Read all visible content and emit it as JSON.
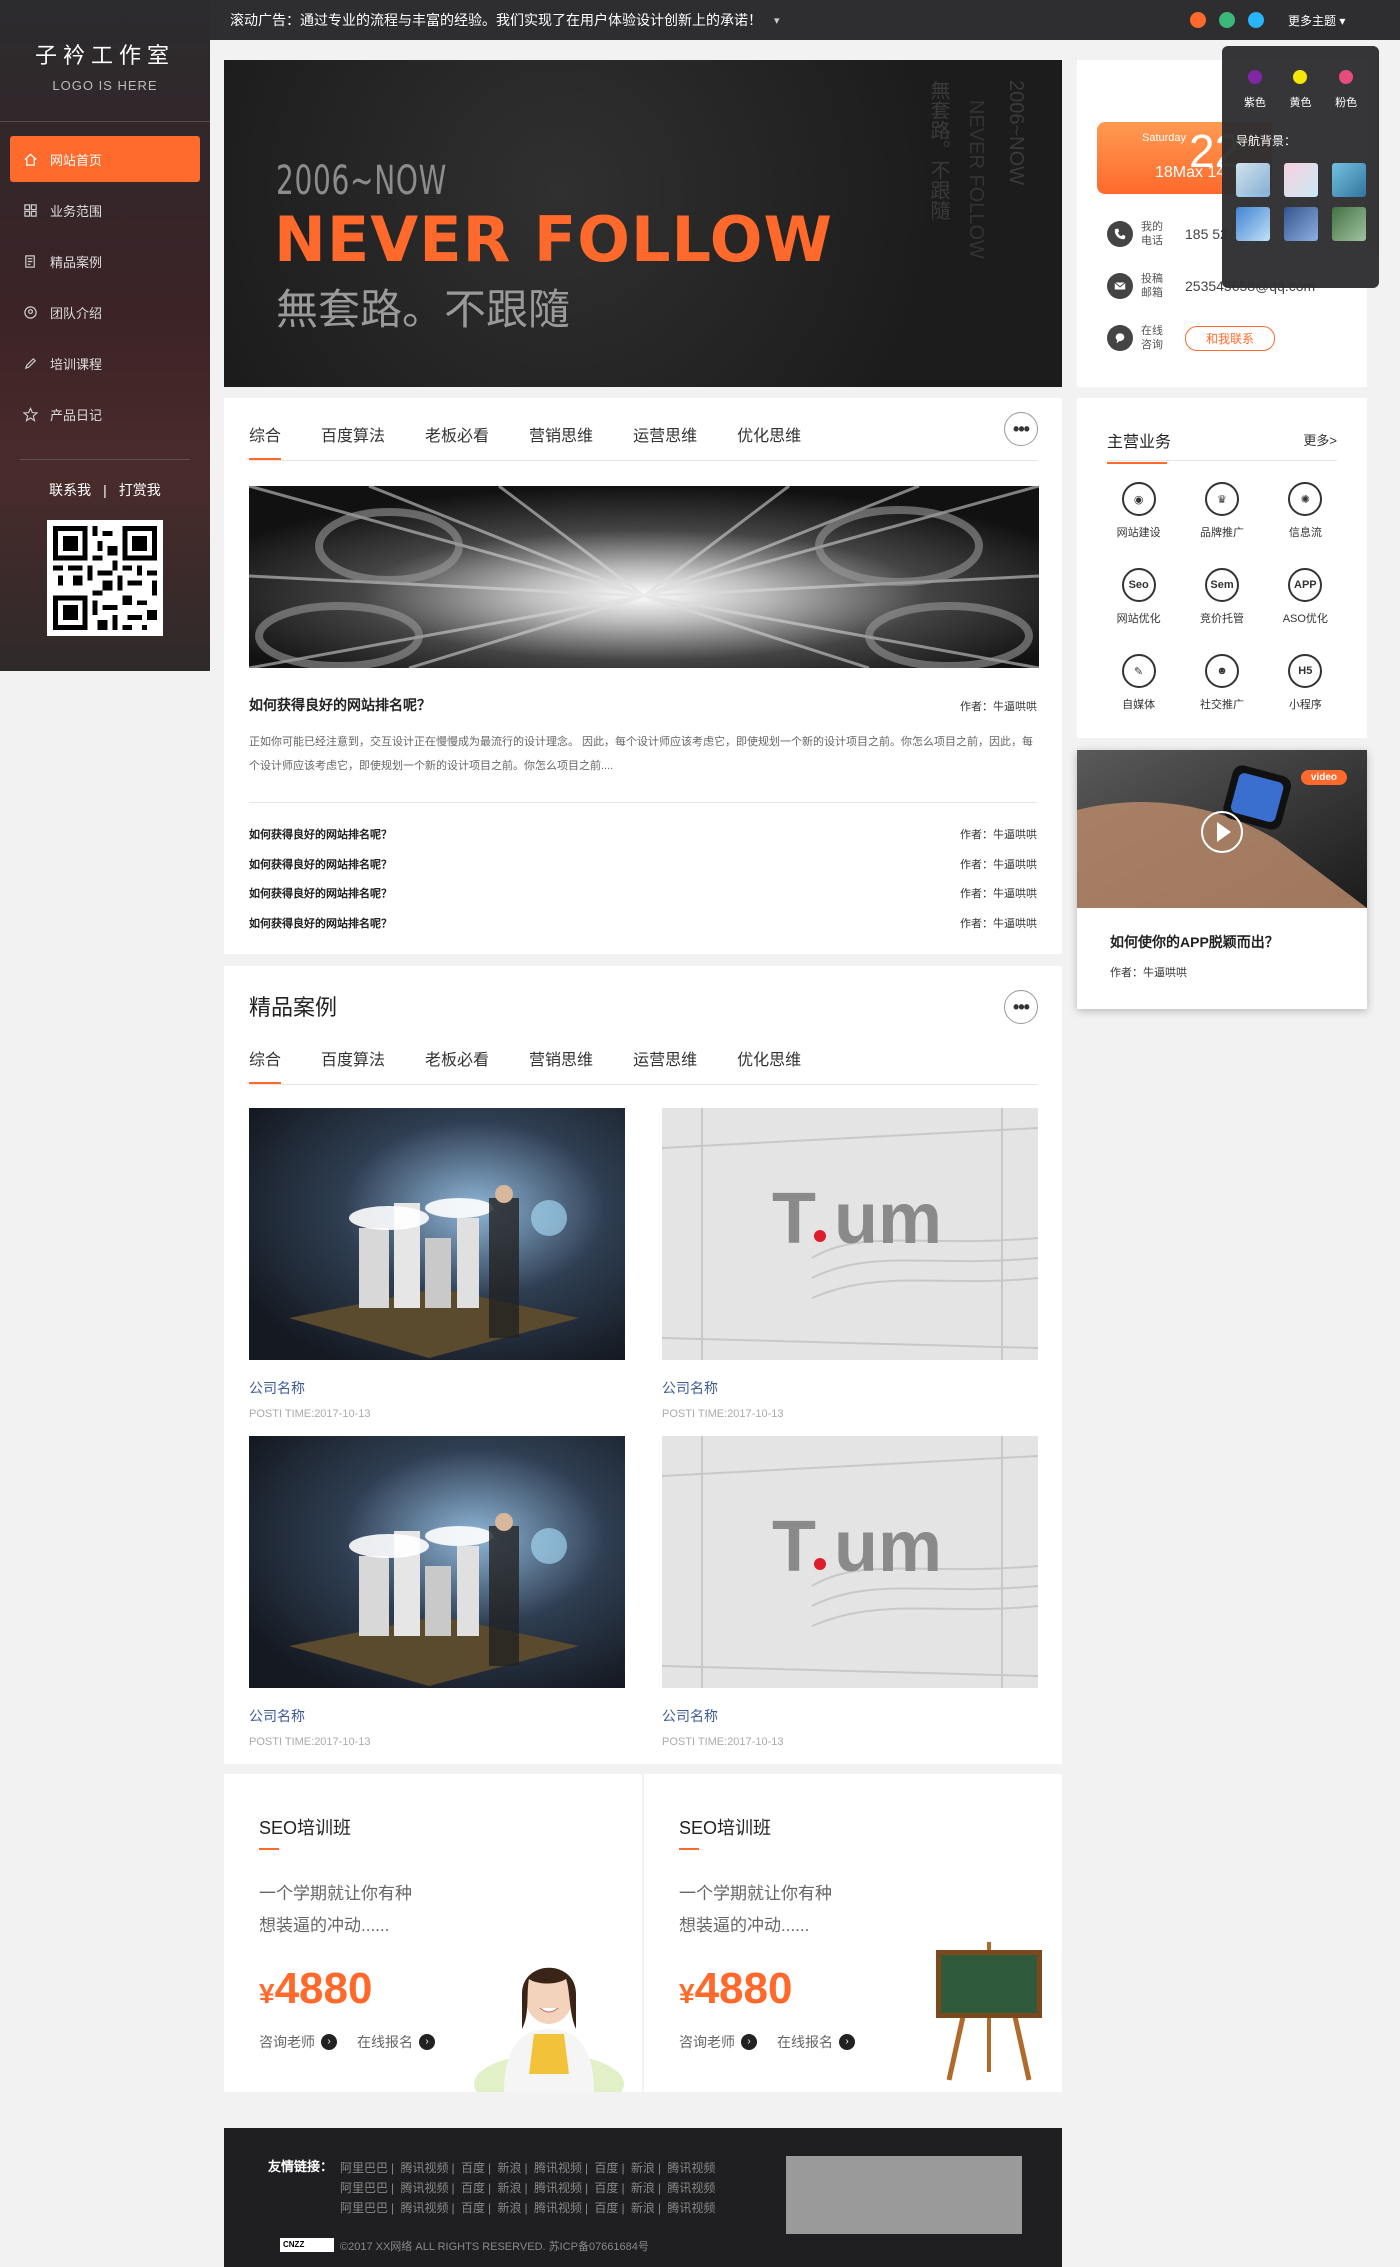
{
  "brand": {
    "name_cn": "子衿工作室",
    "logo_text": "LOGO IS HERE"
  },
  "sidebar": {
    "items": [
      {
        "label": "网站首页",
        "icon": "home-icon",
        "active": true
      },
      {
        "label": "业务范围",
        "icon": "grid-icon"
      },
      {
        "label": "精品案例",
        "icon": "document-icon"
      },
      {
        "label": "团队介绍",
        "icon": "team-icon"
      },
      {
        "label": "培训课程",
        "icon": "pen-icon"
      },
      {
        "label": "产品日记",
        "icon": "star-icon"
      }
    ],
    "link_contact": "联系我",
    "link_separator": "|",
    "link_tip": "打赏我"
  },
  "topbar": {
    "marquee": "滚动广告：通过专业的流程与丰富的经验。我们实现了在用户体验设计创新上的承诺！",
    "more_theme": "更多主题 ▾",
    "dot_colors": [
      "#ff6a2c",
      "#3cb878",
      "#29b6f6"
    ]
  },
  "hero": {
    "year_line": "2006~NOW",
    "headline": "NEVER FOLLOW",
    "subline": "無套路。不跟隨"
  },
  "info": {
    "weekday": "Saturday",
    "day": "22",
    "temps": "18Max 14",
    "phone_label": "我的电话",
    "phone_value": "185 52",
    "email_label": "投稿邮箱",
    "email_value": "253545658@qq.com",
    "consult_label": "在线咨询",
    "consult_button": "和我联系"
  },
  "theme_popup": {
    "colors": [
      {
        "label": "紫色",
        "color": "#7a1fa2"
      },
      {
        "label": "黄色",
        "color": "#f5e400"
      },
      {
        "label": "粉色",
        "color": "#e8457a"
      }
    ],
    "bg_label": "导航背景："
  },
  "news": {
    "tabs": [
      "综合",
      "百度算法",
      "老板必看",
      "营销思维",
      "运营思维",
      "优化思维"
    ],
    "more": "•••",
    "feature_title": "如何获得良好的网站排名呢？",
    "feature_author": "作者：牛逼哄哄",
    "feature_desc": "正如你可能已经注意到，交互设计正在慢慢成为最流行的设计理念。 因此，每个设计师应该考虑它，即使规划一个新的设计项目之前。你怎么项目之前，因此，每个设计师应该考虑它，即使规划一个新的设计项目之前。你怎么项目之前....",
    "list": [
      {
        "title": "如何获得良好的网站排名呢？",
        "author": "作者：牛逼哄哄"
      },
      {
        "title": "如何获得良好的网站排名呢？",
        "author": "作者：牛逼哄哄"
      },
      {
        "title": "如何获得良好的网站排名呢？",
        "author": "作者：牛逼哄哄"
      },
      {
        "title": "如何获得良好的网站排名呢？",
        "author": "作者：牛逼哄哄"
      }
    ]
  },
  "cases": {
    "title": "精品案例",
    "more": "•••",
    "tabs": [
      "综合",
      "百度算法",
      "老板必看",
      "营销思维",
      "运营思维",
      "优化思维"
    ],
    "items": [
      {
        "name": "公司名称",
        "time": "POSTI TIME:2017-10-13"
      },
      {
        "name": "公司名称",
        "time": "POSTI TIME:2017-10-13"
      },
      {
        "name": "公司名称",
        "time": "POSTI TIME:2017-10-13"
      },
      {
        "name": "公司名称",
        "time": "POSTI TIME:2017-10-13"
      }
    ]
  },
  "seo": [
    {
      "title": "SEO培训班",
      "desc1": "一个学期就让你有种",
      "desc2": "想装逼的冲动......",
      "currency": "¥",
      "price": "4880",
      "link1": "咨询老师",
      "link2": "在线报名"
    },
    {
      "title": "SEO培训班",
      "desc1": "一个学期就让你有种",
      "desc2": "想装逼的冲动......",
      "currency": "¥",
      "price": "4880",
      "link1": "咨询老师",
      "link2": "在线报名"
    }
  ],
  "business": {
    "title": "主营业务",
    "more": "更多>",
    "items": [
      {
        "label": "网站建设",
        "glyph": "◉"
      },
      {
        "label": "品牌推广",
        "glyph": "♛"
      },
      {
        "label": "信息流",
        "glyph": "✺"
      },
      {
        "label": "网站优化",
        "glyph": "Seo"
      },
      {
        "label": "竞价托管",
        "glyph": "Sem"
      },
      {
        "label": "ASO优化",
        "glyph": "APP"
      },
      {
        "label": "自媒体",
        "glyph": "✎"
      },
      {
        "label": "社交推广",
        "glyph": "☻"
      },
      {
        "label": "小程序",
        "glyph": "H5"
      }
    ]
  },
  "video": {
    "badge": "video",
    "title": "如何使你的APP脱颖而出？",
    "author": "作者：牛逼哄哄"
  },
  "footer": {
    "links_label": "友情链接：",
    "links": [
      "阿里巴巴",
      "腾讯视频",
      "百度",
      "新浪",
      "腾讯视频",
      "百度",
      "新浪",
      "腾讯视频"
    ],
    "link_sep": "|",
    "cnzz": "CNZZ",
    "copyright": "©2017  XX网络  ALL RIGHTS RESERVED.  苏ICP备07661684号"
  }
}
